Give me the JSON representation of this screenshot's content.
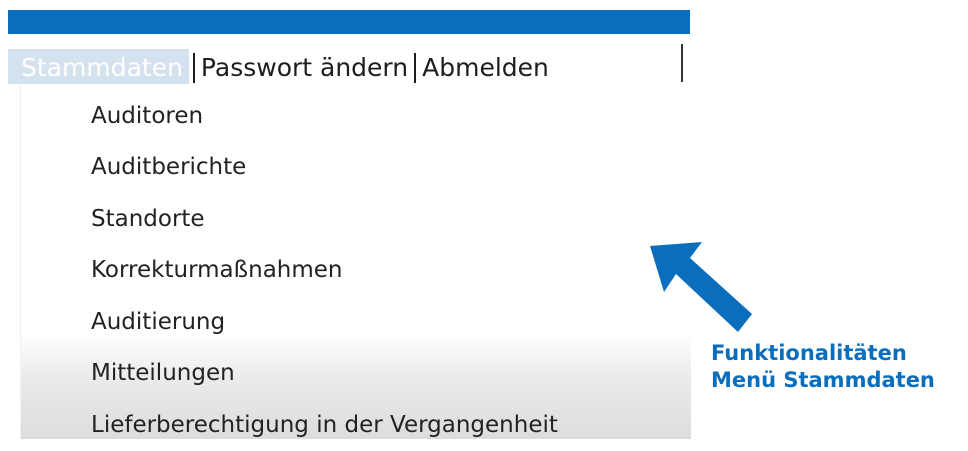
{
  "colors": {
    "accent": "#0a6ebd",
    "active_tab_bg": "#d3e2ee",
    "text": "#1d1d1d"
  },
  "menu": {
    "items": [
      {
        "label": "Stammdaten",
        "active": true
      },
      {
        "label": "Passwort ändern",
        "active": false
      },
      {
        "label": "Abmelden",
        "active": false
      }
    ]
  },
  "dropdown": {
    "items": [
      {
        "label": "Auditoren"
      },
      {
        "label": "Auditberichte"
      },
      {
        "label": "Standorte"
      },
      {
        "label": "Korrekturmaßnahmen"
      },
      {
        "label": "Auditierung"
      },
      {
        "label": "Mitteilungen"
      },
      {
        "label": "Lieferberechtigung in der Vergangenheit"
      }
    ]
  },
  "annotation": {
    "line1": "Funktionalitäten",
    "line2": "Menü Stammdaten",
    "icon": "arrow-pointing-up-left"
  }
}
